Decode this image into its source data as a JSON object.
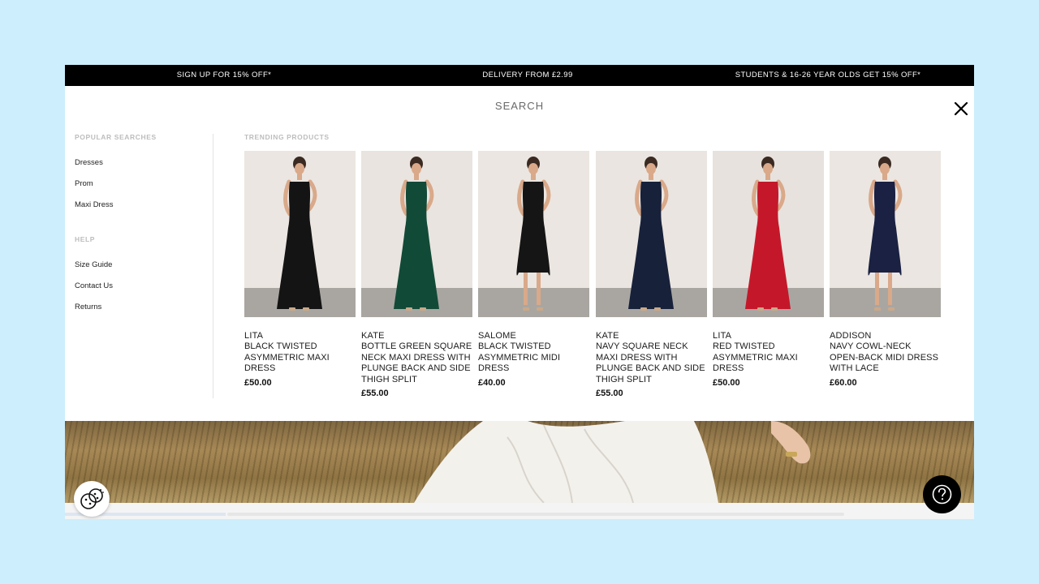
{
  "promo_bar": {
    "items": [
      "SIGN UP FOR 15% OFF*",
      "DELIVERY FROM £2.99",
      "STUDENTS & 16-26 YEAR OLDS GET 15% OFF*"
    ]
  },
  "search": {
    "label": "SEARCH",
    "close_icon": "close-icon"
  },
  "sidebar": {
    "popular_heading": "POPULAR SEARCHES",
    "popular": [
      "Dresses",
      "Prom",
      "Maxi Dress"
    ],
    "help_heading": "HELP",
    "help": [
      "Size Guide",
      "Contact Us",
      "Returns"
    ]
  },
  "trending": {
    "heading": "TRENDING PRODUCTS",
    "products": [
      {
        "brand": "LITA",
        "name": "BLACK TWISTED ASYMMETRIC MAXI DRESS",
        "price": "£50.00",
        "color": "#141414",
        "wall": "#ebe6e1"
      },
      {
        "brand": "KATE",
        "name": "BOTTLE GREEN SQUARE NECK MAXI DRESS WITH PLUNGE BACK AND SIDE THIGH SPLIT",
        "price": "£55.00",
        "color": "#124a38",
        "wall": "#e9e4df"
      },
      {
        "brand": "SALOME",
        "name": "BLACK TWISTED ASYMMETRIC MIDI DRESS",
        "price": "£40.00",
        "color": "#151515",
        "wall": "#ebe6e1"
      },
      {
        "brand": "KATE",
        "name": "NAVY SQUARE NECK MAXI DRESS WITH PLUNGE BACK AND SIDE THIGH SPLIT",
        "price": "£55.00",
        "color": "#17213a",
        "wall": "#eae5e0"
      },
      {
        "brand": "LITA",
        "name": "RED TWISTED ASYMMETRIC MAXI DRESS",
        "price": "£50.00",
        "color": "#c4182a",
        "wall": "#e7e2dd"
      },
      {
        "brand": "ADDISON",
        "name": "NAVY COWL-NECK OPEN-BACK MIDI DRESS WITH LACE",
        "price": "£60.00",
        "color": "#1a2142",
        "wall": "#ebe6e1"
      }
    ]
  },
  "widgets": {
    "cookie_icon": "cookie-icon",
    "help_icon": "help-icon"
  }
}
